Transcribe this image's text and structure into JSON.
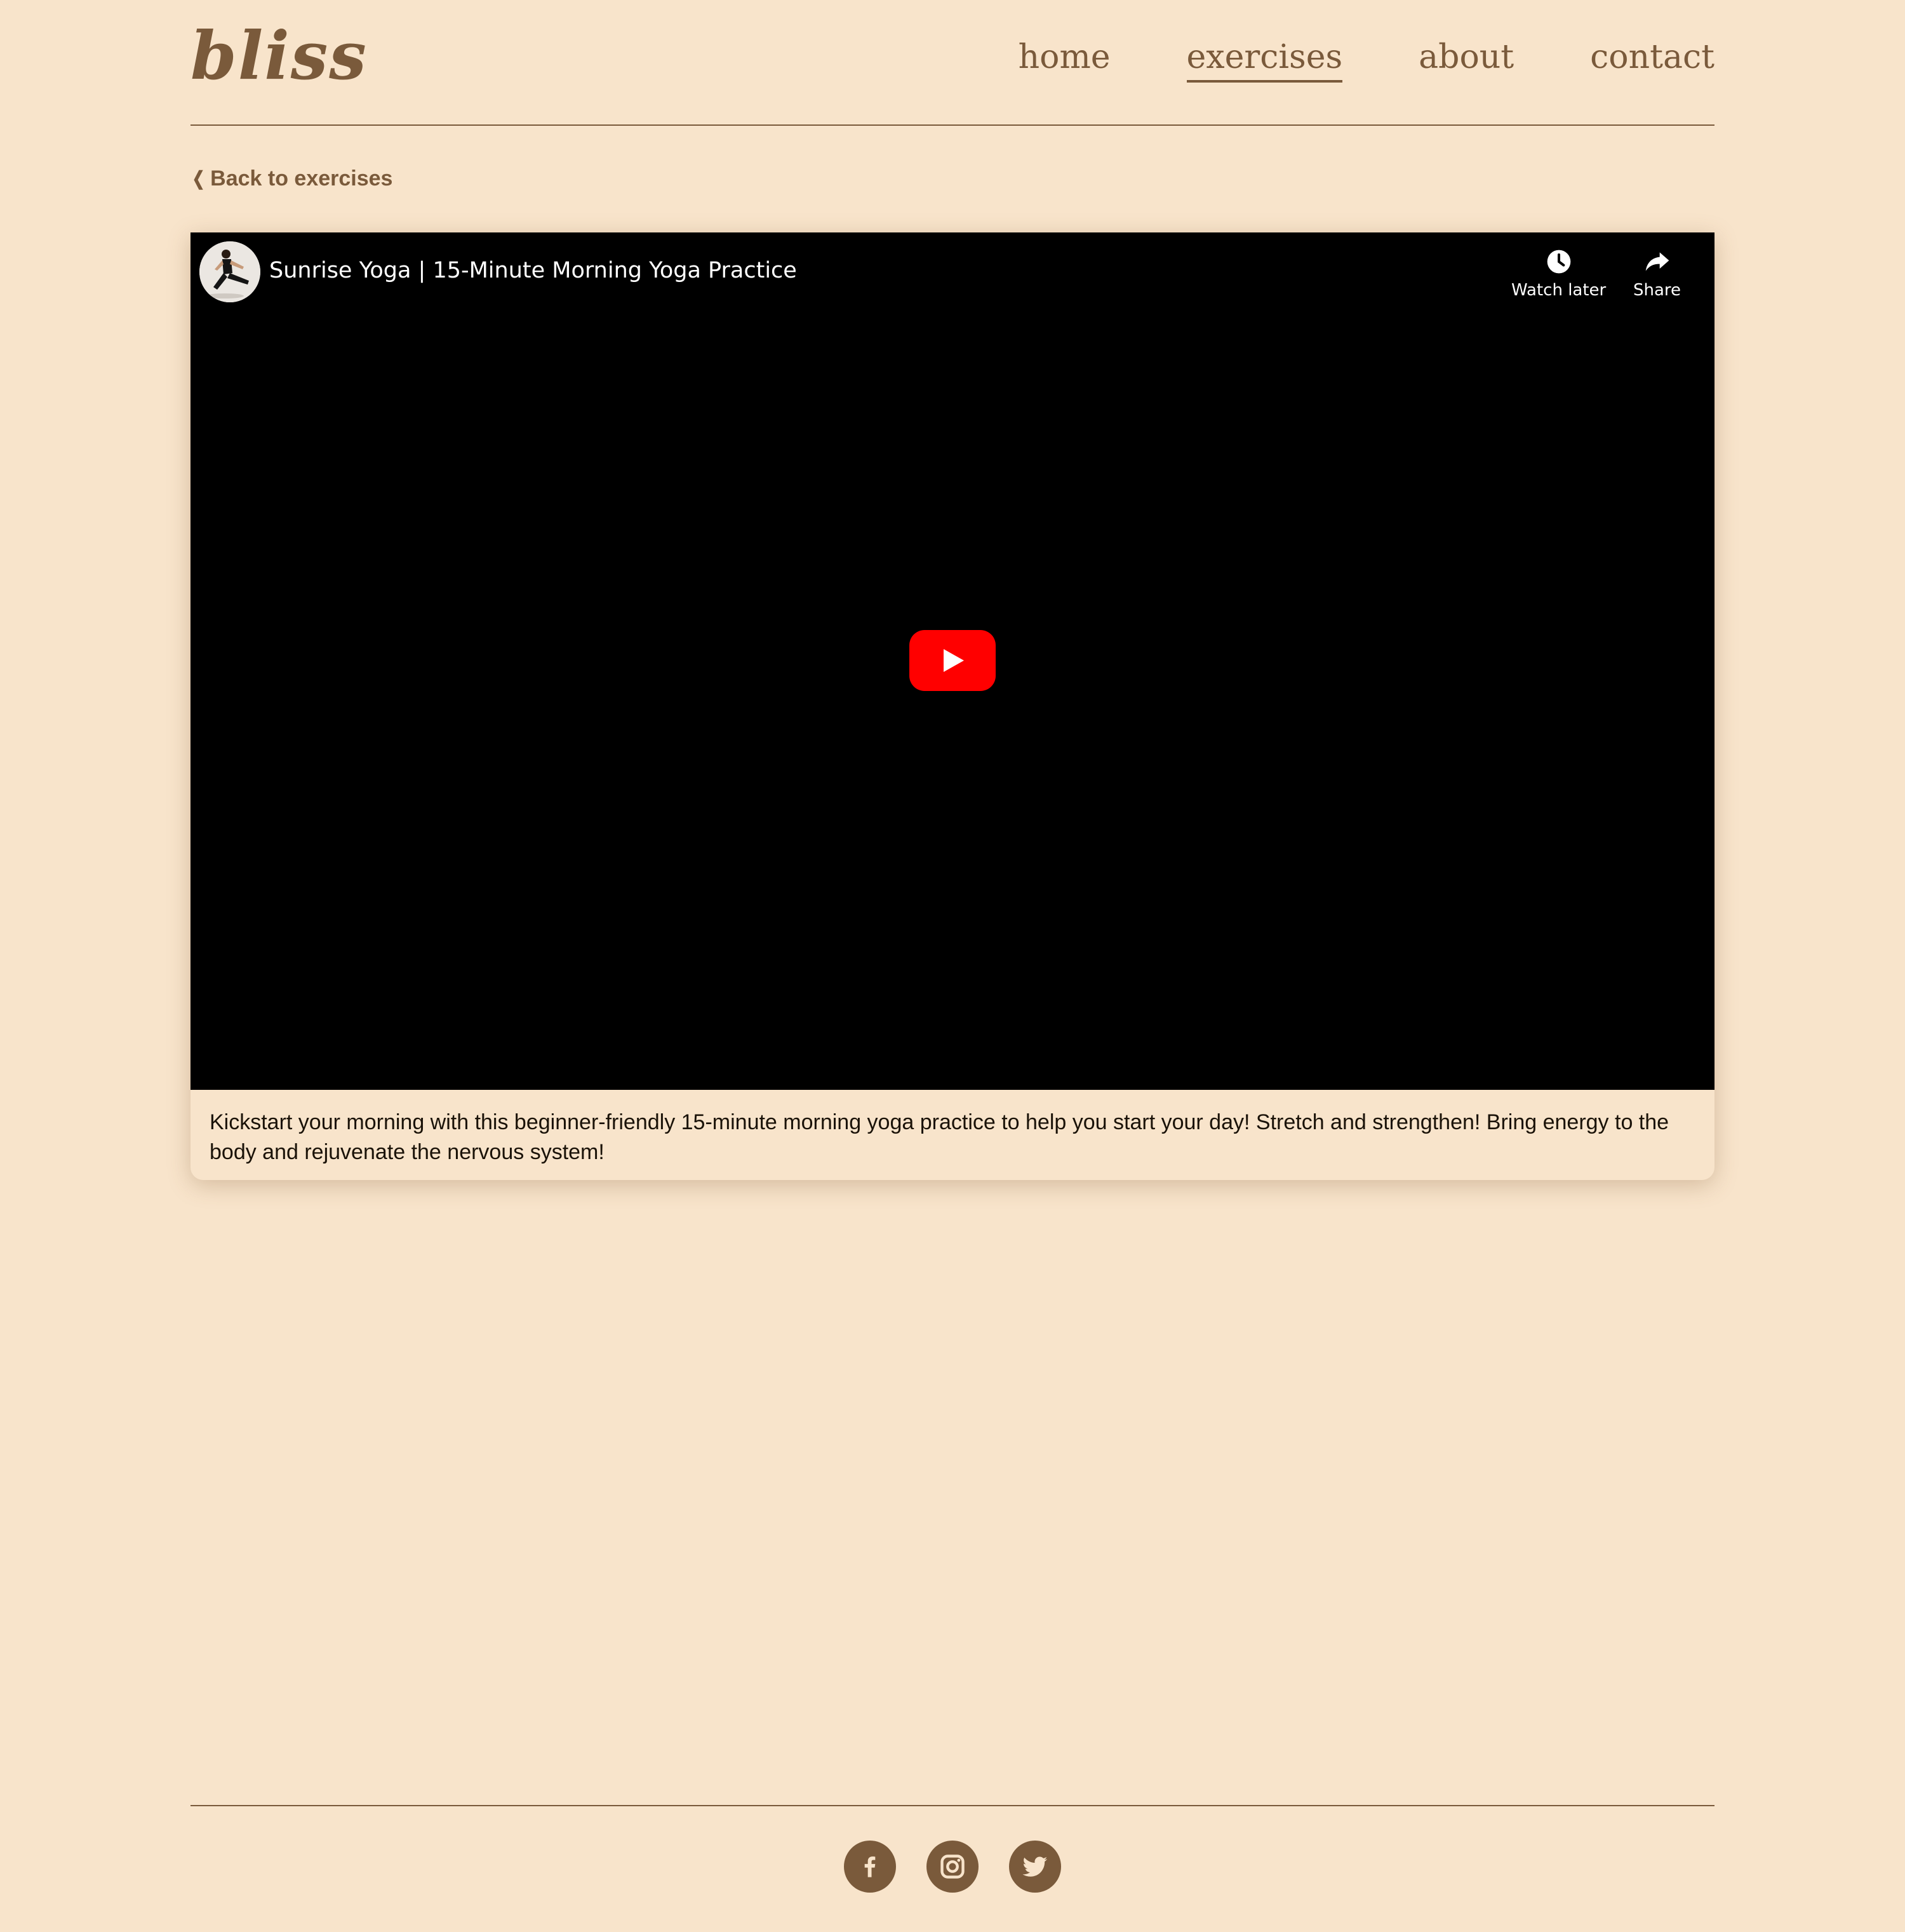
{
  "header": {
    "logo": "bliss",
    "nav": [
      {
        "label": "home",
        "active": false
      },
      {
        "label": "exercises",
        "active": true
      },
      {
        "label": "about",
        "active": false
      },
      {
        "label": "contact",
        "active": false
      }
    ]
  },
  "back_link": {
    "chevron": "❮",
    "label": "Back to exercises"
  },
  "video": {
    "title": "Sunrise Yoga | 15-Minute Morning Yoga Practice",
    "actions": {
      "watch_later": "Watch later",
      "share": "Share"
    },
    "play_icon": "youtube-play-icon"
  },
  "description": "Kickstart your morning with this beginner-friendly 15-minute morning yoga practice to help you start your day! Stretch and strengthen! Bring energy to the body and rejuvenate the nervous system!",
  "footer": {
    "social": [
      "facebook-icon",
      "instagram-icon",
      "twitter-icon"
    ]
  },
  "colors": {
    "background": "#f8e4cb",
    "brand": "#7a5a3b",
    "youtube_red": "#ff0000"
  }
}
